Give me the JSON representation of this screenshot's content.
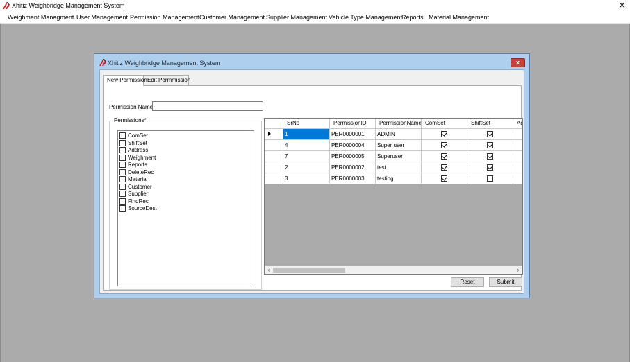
{
  "app": {
    "title": "Xhitiz Weighbridge Management System",
    "close_glyph": "✕"
  },
  "menu": [
    {
      "label": "Weighment Managment"
    },
    {
      "label": "User Management"
    },
    {
      "label": "Permission Management"
    },
    {
      "label": "Customer Management"
    },
    {
      "label": "Supplier Management"
    },
    {
      "label": "Vehicle Type Management"
    },
    {
      "label": "Reports"
    },
    {
      "label": "Material Management"
    }
  ],
  "dialog": {
    "title": "Xhitiz Weighbridge Management System",
    "close_glyph": "x",
    "tabs": [
      {
        "label": "New Permission",
        "active": true
      },
      {
        "label": "Edit Permmission",
        "active": false
      }
    ],
    "form": {
      "name_label": "Permission Name*",
      "name_value": "",
      "permissions_label": "Permissions*",
      "permissions": [
        {
          "label": "ComSet",
          "checked": false
        },
        {
          "label": "ShiftSet",
          "checked": false
        },
        {
          "label": "Address",
          "checked": false
        },
        {
          "label": "Weighment",
          "checked": false
        },
        {
          "label": "Reports",
          "checked": false
        },
        {
          "label": "DeleteRec",
          "checked": false
        },
        {
          "label": "Material",
          "checked": false
        },
        {
          "label": "Customer",
          "checked": false
        },
        {
          "label": "Supplier",
          "checked": false
        },
        {
          "label": "FindRec",
          "checked": false
        },
        {
          "label": "SourceDest",
          "checked": false
        }
      ]
    },
    "grid": {
      "columns": [
        "SrNo",
        "PermissionID",
        "PermissionName",
        "ComSet",
        "ShiftSet",
        "Ad"
      ],
      "rows": [
        {
          "srno": "1",
          "id": "PER0000001",
          "name": "ADMIN",
          "comset": true,
          "shiftset": true,
          "current": true
        },
        {
          "srno": "4",
          "id": "PER0000004",
          "name": "Super user",
          "comset": true,
          "shiftset": true,
          "current": false
        },
        {
          "srno": "7",
          "id": "PER0000005",
          "name": "Superuser",
          "comset": true,
          "shiftset": true,
          "current": false
        },
        {
          "srno": "2",
          "id": "PER0000002",
          "name": "test",
          "comset": true,
          "shiftset": true,
          "current": false
        },
        {
          "srno": "3",
          "id": "PER0000003",
          "name": "testing",
          "comset": true,
          "shiftset": false,
          "current": false
        }
      ],
      "scroll_left": "‹",
      "scroll_right": "›"
    },
    "buttons": {
      "reset": "Reset",
      "submit": "Submit"
    }
  },
  "colors": {
    "selection": "#0078d7",
    "dialog_frame": "#aed0ee",
    "close_red": "#c7423a"
  }
}
